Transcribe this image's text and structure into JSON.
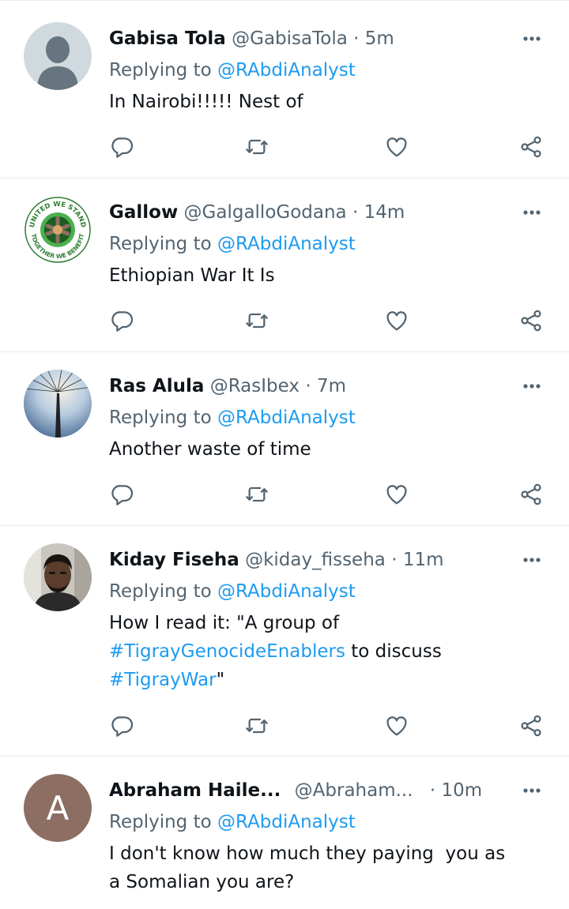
{
  "tweets": [
    {
      "name": "Gabisa Tola",
      "handle": "@GabisaTola",
      "dot": "·",
      "time": "5m",
      "replying_prefix": "Replying to ",
      "replying_to": "@RAbdiAnalyst",
      "text_parts": [
        {
          "t": "In Nairobi!!!!! Nest of",
          "link": false
        }
      ],
      "avatar": "default-profile"
    },
    {
      "name": "Gallow",
      "handle": "@GalgalloGodana",
      "dot": "·",
      "time": "14m",
      "replying_prefix": "Replying to ",
      "replying_to": "@RAbdiAnalyst",
      "text_parts": [
        {
          "t": "Ethiopian War It Is",
          "link": false
        }
      ],
      "avatar": "emblem",
      "avatar_text_top": "UNITED WE STAND",
      "avatar_text_bottom": "TOGETHER WE BENEFIT"
    },
    {
      "name": "Ras Alula",
      "handle": "@RasIbex",
      "dot": "·",
      "time": "7m",
      "replying_prefix": "Replying to ",
      "replying_to": "@RAbdiAnalyst",
      "text_parts": [
        {
          "t": "Another waste of time",
          "link": false
        }
      ],
      "avatar": "sky-tower"
    },
    {
      "name": "Kiday Fiseha",
      "handle": "@kiday_fisseha",
      "dot": "·",
      "time": "11m",
      "replying_prefix": "Replying to ",
      "replying_to": "@RAbdiAnalyst",
      "text_parts": [
        {
          "t": "How I read it: \"A group of\n",
          "link": false
        },
        {
          "t": "#TigrayGenocideEnablers",
          "link": true
        },
        {
          "t": " to discuss\n",
          "link": false
        },
        {
          "t": "#TigrayWar",
          "link": true
        },
        {
          "t": "\"",
          "link": false
        }
      ],
      "avatar": "person-photo"
    },
    {
      "name": "Abraham Haile...",
      "handle": "@Abraham...",
      "dot": "·",
      "time": "10m",
      "replying_prefix": "Replying to ",
      "replying_to": "@RAbdiAnalyst",
      "text_parts": [
        {
          "t": "I don't know how much they paying  you as\na Somalian you are?",
          "link": false
        }
      ],
      "avatar": "initial",
      "avatar_letter": "A"
    }
  ],
  "colors": {
    "accent": "#1d9bf0",
    "secondary_text": "#536471",
    "divider": "#e6ecf0",
    "avatar_initial_bg": "#8d6e63"
  }
}
